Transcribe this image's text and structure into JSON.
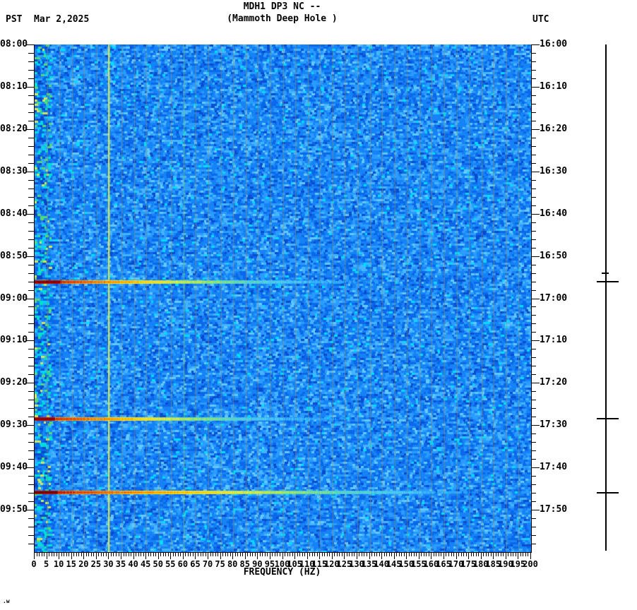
{
  "header": {
    "tz_left": "PST",
    "date": "Mar 2,2025",
    "title_line1": "MDH1 DP3 NC --",
    "title_line2": "(Mammoth Deep Hole )",
    "tz_right": "UTC"
  },
  "x_axis": {
    "label": "FREQUENCY (HZ)",
    "min_hz": 0,
    "max_hz": 200,
    "label_step_hz": 5,
    "minor_step_hz": 1,
    "tick_labels": [
      "0",
      "5",
      "10",
      "15",
      "20",
      "25",
      "30",
      "35",
      "40",
      "45",
      "50",
      "55",
      "60",
      "65",
      "70",
      "75",
      "80",
      "85",
      "90",
      "95",
      "100",
      "105",
      "110",
      "115",
      "120",
      "125",
      "130",
      "135",
      "140",
      "145",
      "150",
      "155",
      "160",
      "165",
      "170",
      "175",
      "180",
      "185",
      "190",
      "195",
      "200"
    ]
  },
  "left_axis": {
    "timezone": "PST",
    "labels": [
      "08:00",
      "08:10",
      "08:20",
      "08:30",
      "08:40",
      "08:50",
      "09:00",
      "09:10",
      "09:20",
      "09:30",
      "09:40",
      "09:50"
    ],
    "step_minutes": 10,
    "minor_step_minutes": 2
  },
  "right_axis": {
    "timezone": "UTC",
    "labels": [
      "16:00",
      "16:10",
      "16:20",
      "16:30",
      "16:40",
      "16:50",
      "17:00",
      "17:10",
      "17:20",
      "17:30",
      "17:40",
      "17:50"
    ]
  },
  "watermark": ".w",
  "chart_data": {
    "type": "heatmap",
    "title": "MDH1 DP3 NC -- (Mammoth Deep Hole )",
    "date_pst": "Mar 2,2025",
    "xlabel": "FREQUENCY (HZ)",
    "x_range_hz": [
      0,
      200
    ],
    "time_span_pst": [
      "08:00",
      "10:00"
    ],
    "time_span_utc": [
      "16:00",
      "18:00"
    ],
    "time_tick_interval_min": 10,
    "background": "random blue spectrogram noise",
    "grid_lines_every_hz": 5,
    "persistent_tones_hz": [
      30,
      60
    ],
    "low_freq_noise_band_hz": [
      0,
      6
    ],
    "events": [
      {
        "time_pst": "08:56",
        "time_utc": "16:56",
        "start_min": 56.0,
        "strength": 1.0,
        "core_hz": 10,
        "stripe_hz": 28,
        "warm_hz": 55,
        "cool_hz": 95
      },
      {
        "time_pst": "09:28",
        "time_utc": "17:28",
        "start_min": 88.5,
        "strength": 0.97,
        "core_hz": 8,
        "stripe_hz": 28,
        "warm_hz": 52,
        "cool_hz": 88
      },
      {
        "time_pst": "09:46",
        "time_utc": "17:46",
        "start_min": 105.8,
        "strength": 1.03,
        "core_hz": 9,
        "stripe_hz": 36,
        "warm_hz": 80,
        "cool_hz": 138
      }
    ],
    "scalebar_ticks": [
      {
        "minute": 54,
        "size": "small"
      },
      {
        "minute": 56,
        "size": "large"
      },
      {
        "minute": 88.5,
        "size": "large"
      },
      {
        "minute": 106,
        "size": "large"
      }
    ]
  },
  "colors": {
    "background": "#ffffff",
    "text": "#000000",
    "spectrogram_base": "#1583f5",
    "tone_30hz": "#d8e855",
    "tone_60hz": "#6ed778",
    "grid_faint": "#91906a",
    "event_core": "#700000",
    "event_hot": "#cf1000",
    "event_warm": "#ffd000",
    "event_cool": "#5fd9b0"
  }
}
